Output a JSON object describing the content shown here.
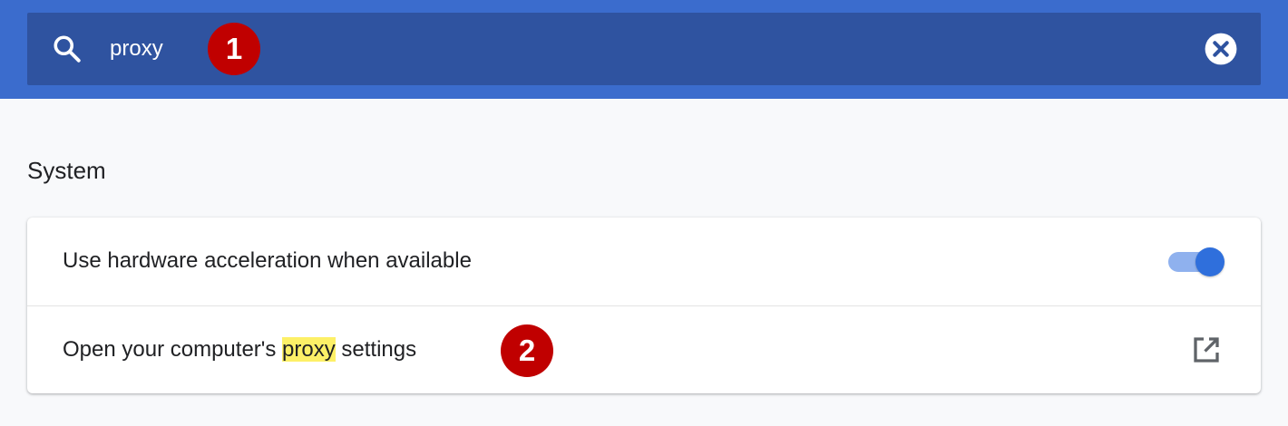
{
  "search": {
    "value": "proxy",
    "icon": "search-icon",
    "clear_icon": "clear-icon"
  },
  "annotations": {
    "callout_1": "1",
    "callout_2": "2"
  },
  "section": {
    "title": "System"
  },
  "settings": {
    "hardware_acceleration": {
      "label": "Use hardware acceleration when available",
      "enabled": true
    },
    "proxy": {
      "label_before": "Open your computer's ",
      "label_highlight": "proxy",
      "label_after": " settings",
      "icon": "open-external-icon"
    }
  },
  "colors": {
    "header": "#3b6ccd",
    "search_box": "#2f53a0",
    "accent": "#2f6fdc",
    "callout": "#c00000",
    "highlight": "#fdf067"
  }
}
